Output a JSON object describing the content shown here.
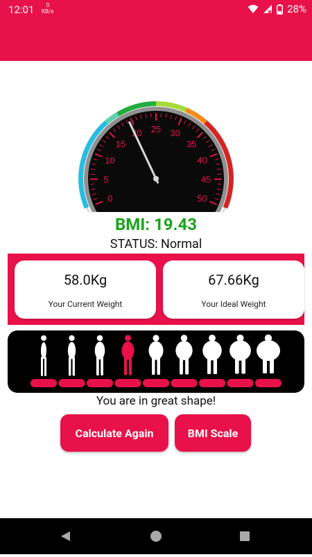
{
  "status_bar": {
    "time": "12:01",
    "net_speed_value": "0",
    "net_speed_unit": "KB/s",
    "battery": "28%"
  },
  "gauge": {
    "ticks": [
      "0",
      "5",
      "10",
      "15",
      "20",
      "25",
      "30",
      "35",
      "40",
      "45",
      "50"
    ],
    "value": 19.43,
    "range": [
      0,
      50
    ],
    "needle_color": "#d9d9d9",
    "label_color": "#e8114a"
  },
  "result": {
    "bmi": "BMI: 19.43",
    "status": "STATUS: Normal",
    "message": "You are in great shape!"
  },
  "weights": {
    "current": {
      "value": "58.0Kg",
      "label": "Your Current Weight"
    },
    "ideal": {
      "value": "67.66Kg",
      "label": "Your Ideal Weight"
    }
  },
  "body_scale": {
    "count": 9,
    "active_index": 3
  },
  "buttons": {
    "calculate": "Calculate Again",
    "scale": "BMI Scale"
  },
  "colors": {
    "accent": "#e8114a",
    "bmi_green": "#1ba31b"
  }
}
